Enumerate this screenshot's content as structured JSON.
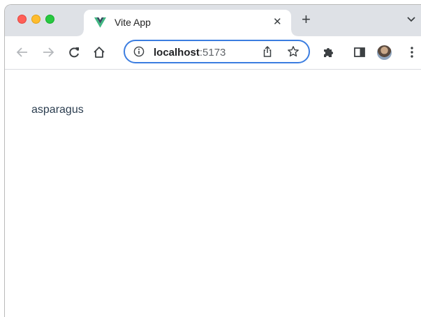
{
  "tab": {
    "title": "Vite App",
    "favicon": "vue-logo-icon",
    "close_symbol": "✕",
    "new_tab_symbol": "+"
  },
  "toolbar": {
    "url_host": "localhost",
    "url_port": ":5173"
  },
  "page": {
    "text": "asparagus"
  },
  "colors": {
    "tabstrip": "#dee1e6",
    "omnibox_border": "#3b7de0",
    "content_text": "#2c3e50",
    "vue_green": "#41b883",
    "vue_dark": "#35495e"
  }
}
